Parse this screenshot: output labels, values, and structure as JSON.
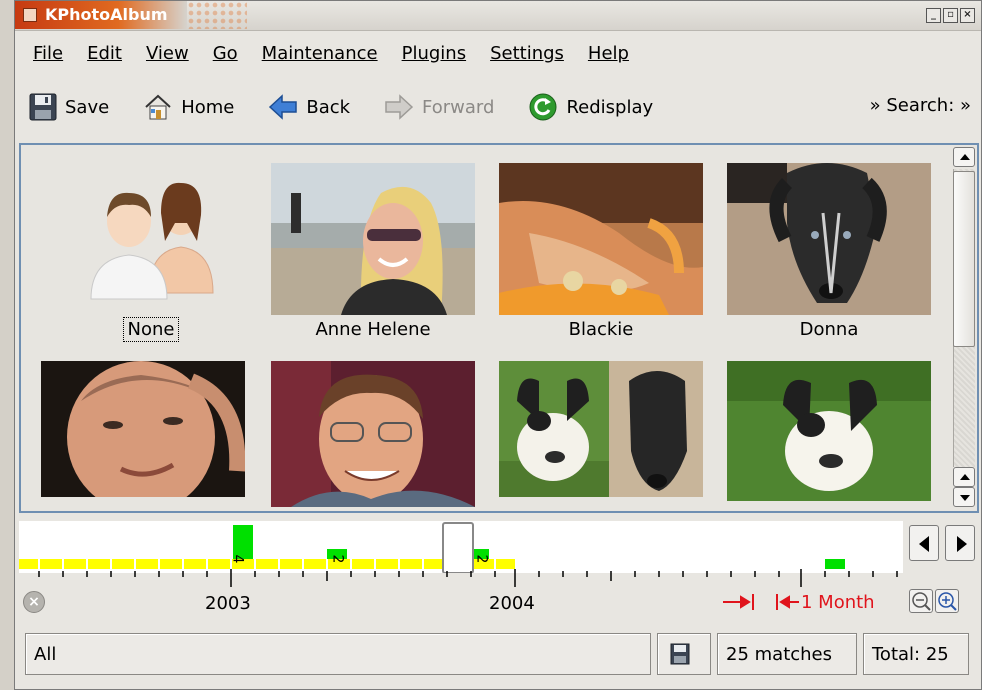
{
  "window": {
    "title": "KPhotoAlbum"
  },
  "menu": [
    "File",
    "Edit",
    "View",
    "Go",
    "Maintenance",
    "Plugins",
    "Settings",
    "Help"
  ],
  "toolbar": {
    "save": "Save",
    "home": "Home",
    "back": "Back",
    "forward": "Forward",
    "redisplay": "Redisplay",
    "search": "» Search: »"
  },
  "people": [
    {
      "name": "None"
    },
    {
      "name": "Anne Helene"
    },
    {
      "name": "Blackie"
    },
    {
      "name": "Donna"
    },
    {
      "name": ""
    },
    {
      "name": ""
    },
    {
      "name": ""
    },
    {
      "name": ""
    }
  ],
  "timeline": {
    "years": [
      "2003",
      "2004"
    ],
    "counts": [
      "4",
      "2",
      "2"
    ],
    "range_label": "1 Month"
  },
  "status": {
    "filter": "All",
    "matches": "25 matches",
    "total": "Total: 25"
  },
  "colors": {
    "bar_yellow": "#ffff00",
    "bar_green": "#00e000",
    "range_red": "#e0141c",
    "selection_blue": "#6f8fb2"
  }
}
